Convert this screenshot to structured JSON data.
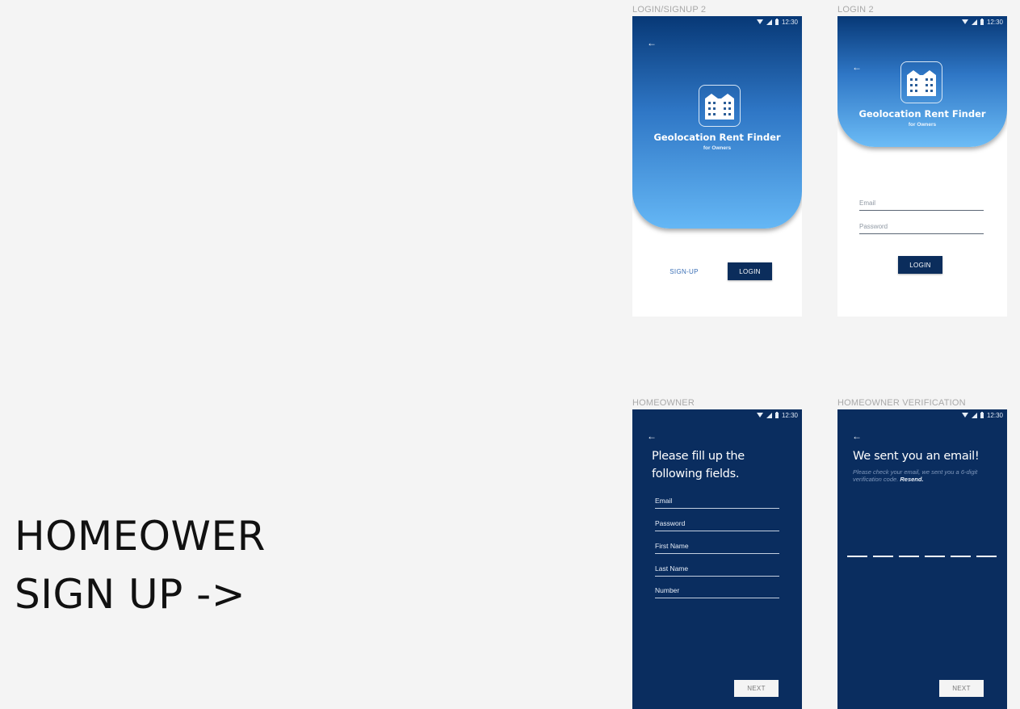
{
  "page_title": {
    "line1": "HOMEOWER",
    "line2": "SIGN UP ->"
  },
  "status_bar": {
    "time": "12:30"
  },
  "screens": {
    "login_signup": {
      "label": "LOGIN/SIGNUP 2",
      "app_name": "Geolocation Rent Finder",
      "app_sub": "for Owners",
      "signup_label": "SIGN-UP",
      "login_label": "LOGIN"
    },
    "login": {
      "label": "LOGIN 2",
      "app_name": "Geolocation Rent Finder",
      "app_sub": "for Owners",
      "email_placeholder": "Email",
      "password_placeholder": "Password",
      "login_label": "LOGIN"
    },
    "homeowner": {
      "label": "HOMEOWNER",
      "heading_line1": "Please fill up the",
      "heading_line2": "following fields.",
      "fields": [
        "Email",
        "Password",
        "First Name",
        "Last Name",
        "Number"
      ],
      "next_label": "NEXT"
    },
    "verification": {
      "label": "HOMEOWNER VERIFICATION",
      "heading": "We sent you an email!",
      "hint_text": "Please check your email, we sent you a 6-digit verification code.",
      "resend_label": "Resend.",
      "code_length": 6,
      "next_label": "NEXT"
    }
  },
  "colors": {
    "navy": "#0a2d5f",
    "button_dark": "#0b2d5c",
    "gradient_top": "#073876",
    "gradient_bottom": "#65b7f5",
    "link_blue": "#3a6fb6",
    "background": "#f4f4f4"
  },
  "icons": [
    "back-arrow-icon",
    "wifi-icon",
    "signal-icon",
    "battery-icon",
    "building-logo-icon"
  ]
}
